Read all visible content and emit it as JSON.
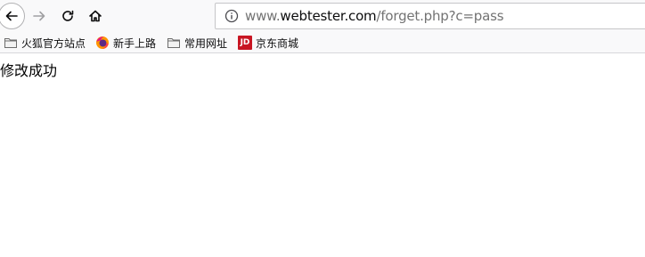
{
  "toolbar": {
    "icons": [
      "back-arrow-icon",
      "forward-arrow-icon",
      "reload-icon",
      "home-icon"
    ],
    "url": {
      "prefix": "www.",
      "host": "webtester.com",
      "path": "/forget.php?c=pass"
    }
  },
  "bookmarks": {
    "items": [
      {
        "label": "火狐官方站点",
        "icon": "folder-icon"
      },
      {
        "label": "新手上路",
        "icon": "firefox-logo-icon"
      },
      {
        "label": "常用网址",
        "icon": "folder-icon"
      },
      {
        "label": "京东商城",
        "icon": "jd-logo-icon",
        "icon_text": "JD"
      }
    ]
  },
  "page": {
    "message": "修改成功"
  },
  "colors": {
    "toolbar_bg": "#f9f9fa",
    "jd_red": "#c81623",
    "url_dim": "#737373"
  }
}
